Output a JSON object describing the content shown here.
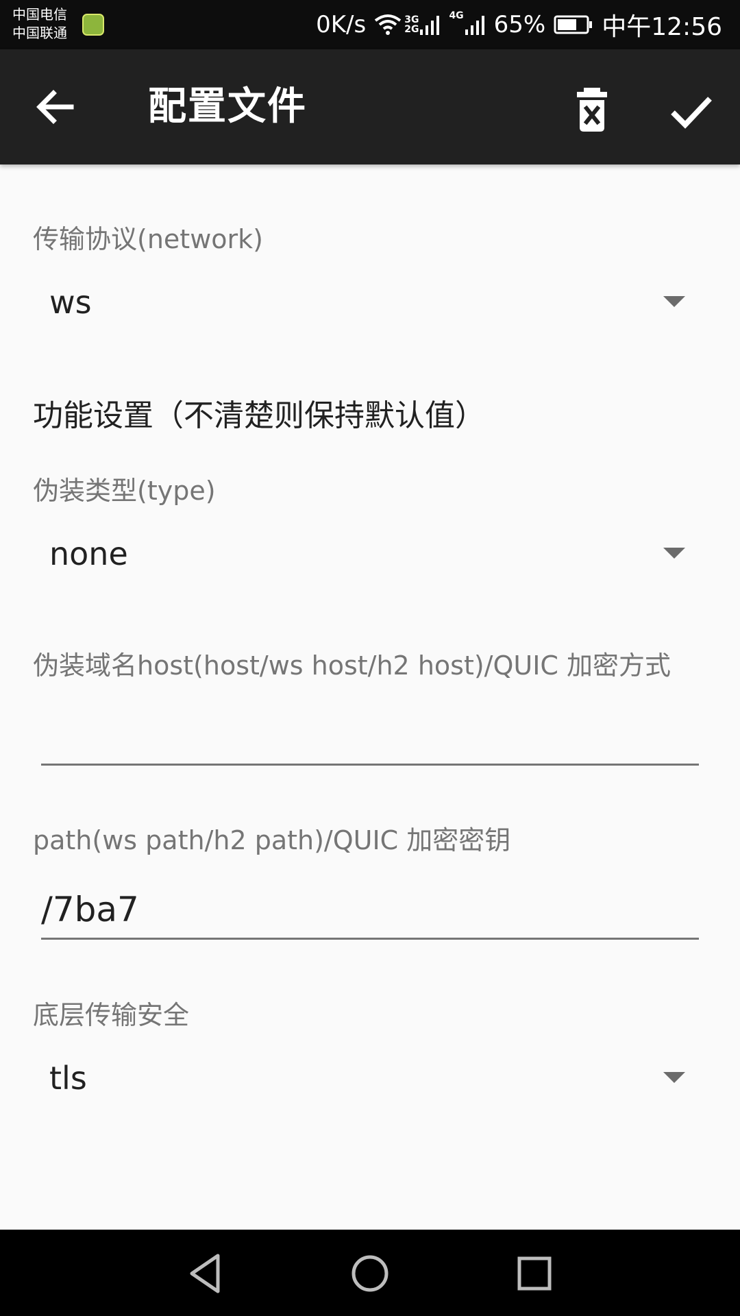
{
  "status_bar": {
    "carrier1": "中国电信",
    "carrier2": "中国联通",
    "net_speed": "0K/s",
    "net_tag_top": "3G",
    "net_tag_bottom": "2G",
    "net_tag_4g": "4G",
    "battery_percent": "65%",
    "time": "中午12:56"
  },
  "app_bar": {
    "title": "配置文件",
    "back_icon": "arrow-left-icon",
    "delete_icon": "trash-icon",
    "confirm_icon": "check-icon"
  },
  "form": {
    "network_label": "传输协议(network)",
    "network_value": "ws",
    "section_title": "功能设置（不清楚则保持默认值）",
    "type_label": "伪装类型(type)",
    "type_value": "none",
    "host_label": "伪装域名host(host/ws host/h2 host)/QUIC 加密方式",
    "host_value": "",
    "path_label": "path(ws path/h2 path)/QUIC 加密密钥",
    "path_value": "/7ba7",
    "security_label": "底层传输安全",
    "security_value": "tls"
  },
  "nav_bar": {
    "back": "triangle-back-icon",
    "home": "circle-home-icon",
    "recents": "square-recents-icon"
  },
  "colors": {
    "status_bar": "#0d0d0d",
    "app_bar": "#212121",
    "background": "#fafafa",
    "label": "#757575",
    "text": "#212121"
  }
}
